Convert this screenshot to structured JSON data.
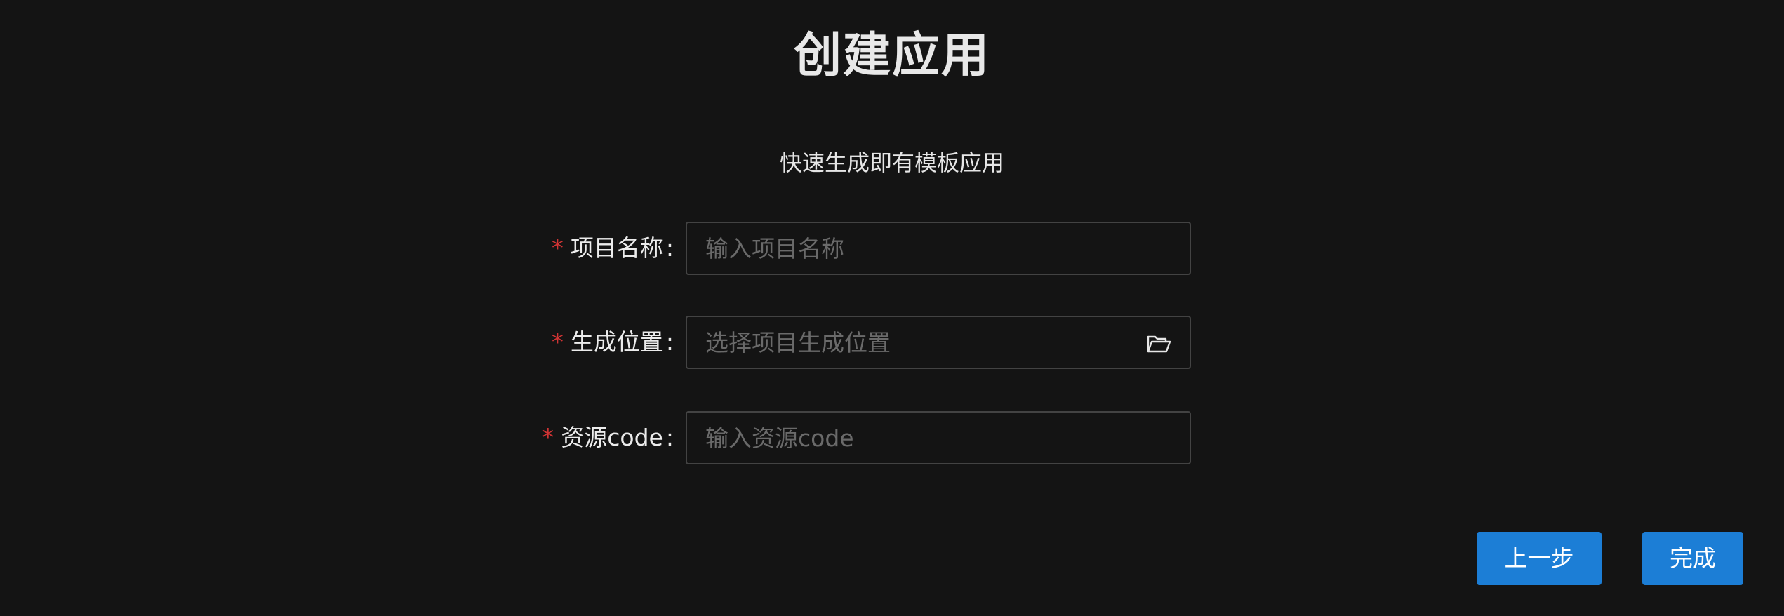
{
  "header": {
    "title": "创建应用",
    "subtitle": "快速生成即有模板应用"
  },
  "form": {
    "project_name": {
      "label": "项目名称",
      "required_mark": "*",
      "colon": ":",
      "value": "",
      "placeholder": "输入项目名称"
    },
    "location": {
      "label": "生成位置",
      "required_mark": "*",
      "colon": ":",
      "value": "",
      "placeholder": "选择项目生成位置",
      "icon": "folder-open-icon"
    },
    "resource_code": {
      "label": "资源code",
      "required_mark": "*",
      "colon": ":",
      "value": "",
      "placeholder": "输入资源code"
    }
  },
  "actions": {
    "prev_label": "上一步",
    "finish_label": "完成"
  },
  "colors": {
    "background": "#141414",
    "primary": "#1c7ed6",
    "required": "#d13434",
    "border": "#434343",
    "placeholder": "#6a6a6a"
  }
}
